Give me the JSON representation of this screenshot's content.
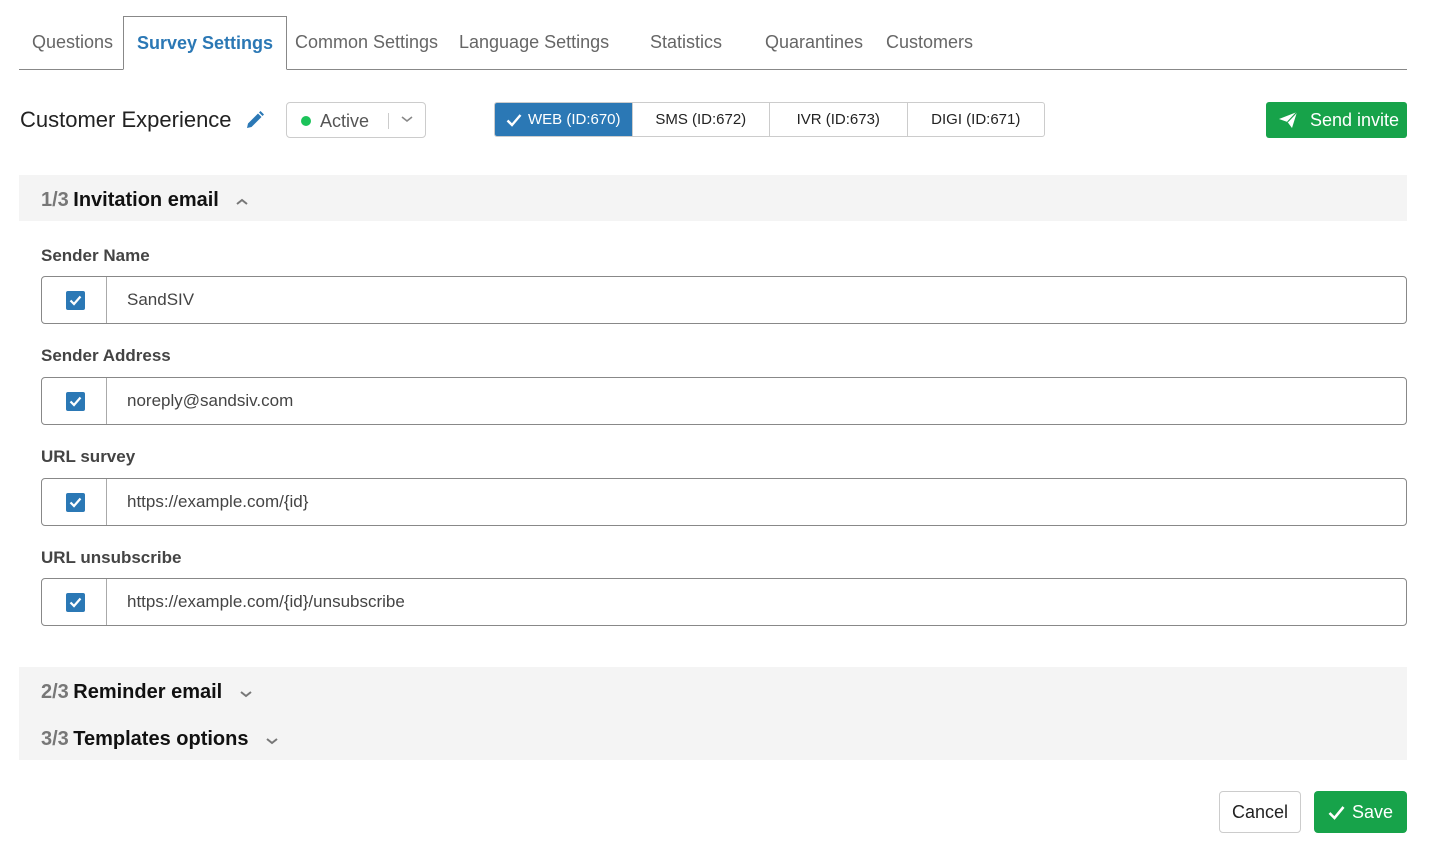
{
  "tabs": [
    {
      "label": "Questions"
    },
    {
      "label": "Survey Settings",
      "active": true
    },
    {
      "label": "Common Settings"
    },
    {
      "label": "Language Settings"
    },
    {
      "label": "Statistics"
    },
    {
      "label": "Quarantines"
    },
    {
      "label": "Customers"
    }
  ],
  "header": {
    "survey_name": "Customer Experience",
    "status": "Active",
    "channels": [
      {
        "label": "WEB (ID:670)",
        "active": true
      },
      {
        "label": "SMS (ID:672)"
      },
      {
        "label": "IVR (ID:673)"
      },
      {
        "label": "DIGI (ID:671)"
      }
    ],
    "send_invite_label": "Send invite"
  },
  "sections": [
    {
      "num": "1/3",
      "title": "Invitation email",
      "expanded": true
    },
    {
      "num": "2/3",
      "title": "Reminder email",
      "expanded": false
    },
    {
      "num": "3/3",
      "title": "Templates options",
      "expanded": false
    }
  ],
  "fields": [
    {
      "label": "Sender Name",
      "value": "SandSIV",
      "checked": true
    },
    {
      "label": "Sender Address",
      "value": "noreply@sandsiv.com",
      "checked": true
    },
    {
      "label": "URL survey",
      "value": "https://example.com/{id}",
      "checked": true
    },
    {
      "label": "URL unsubscribe",
      "value": "https://example.com/{id}/unsubscribe",
      "checked": true
    }
  ],
  "footer": {
    "cancel_label": "Cancel",
    "save_label": "Save"
  },
  "colors": {
    "accent": "#2b78b5",
    "success": "#17a34a",
    "status_dot": "#1cc35a"
  }
}
